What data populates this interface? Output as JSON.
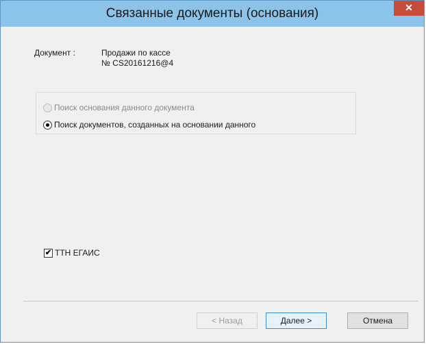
{
  "window": {
    "title": "Связанные документы (основания)",
    "close_glyph": "✕"
  },
  "document": {
    "label": "Документ :",
    "name_line1": "Продажи по кассе",
    "name_line2": "№ CS20161216@4"
  },
  "search_options": [
    {
      "label": "Поиск основания данного документа",
      "selected": false,
      "enabled": false
    },
    {
      "label": "Поиск документов, созданных на основании данного",
      "selected": true,
      "enabled": true
    }
  ],
  "filters": {
    "ttn_egais_label": "ТТН ЕГАИС",
    "ttn_egais_checked": true,
    "check_glyph": "✔"
  },
  "buttons": {
    "back_label": "< Назад",
    "next_label": "Далее >",
    "cancel_label": "Отмена"
  },
  "colors": {
    "titlebar": "#8cc3e8",
    "close": "#c74a3a",
    "default_button_border": "#3c8ad0"
  }
}
